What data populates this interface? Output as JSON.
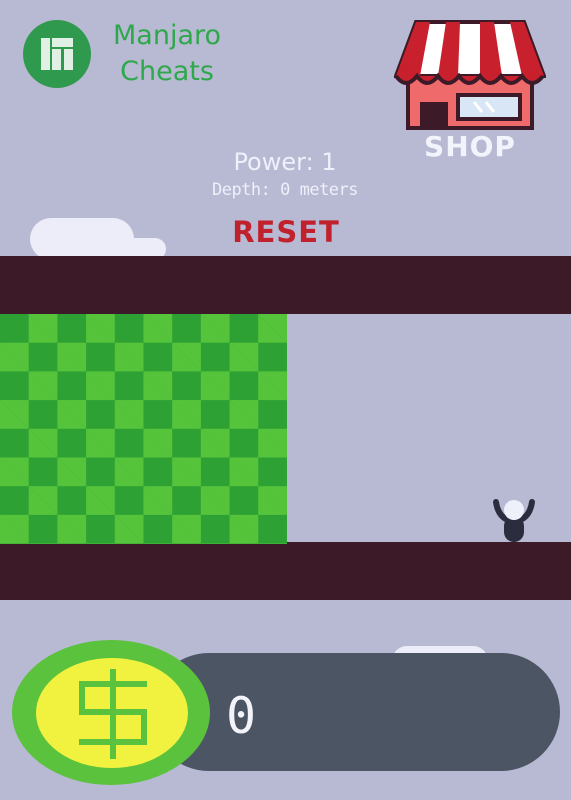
{
  "header": {
    "title_line1": "Manjaro",
    "title_line2": "Cheats",
    "logo_icon": "manjaro-logo-icon"
  },
  "shop": {
    "label": "SHOP",
    "icon": "storefront-icon",
    "colors": {
      "awning_red": "#c9202e",
      "awning_white": "#ffffff",
      "wall": "#ef6b6b",
      "outline": "#3c1a27"
    }
  },
  "hud": {
    "power": "Power: 1",
    "depth": "Depth: 0 meters",
    "reset_label": "RESET"
  },
  "world": {
    "ground_color": "#3c1a27",
    "sky_color": "#b8b9d3",
    "grass_dark": "#2ea134",
    "grass_light": "#55c43b"
  },
  "wallet": {
    "coins": "0",
    "coin_icon": "dollar-sign-icon",
    "colors": {
      "coin_rim": "#5ac23c",
      "coin_face": "#f1f13f",
      "bar": "#4c5563"
    }
  }
}
